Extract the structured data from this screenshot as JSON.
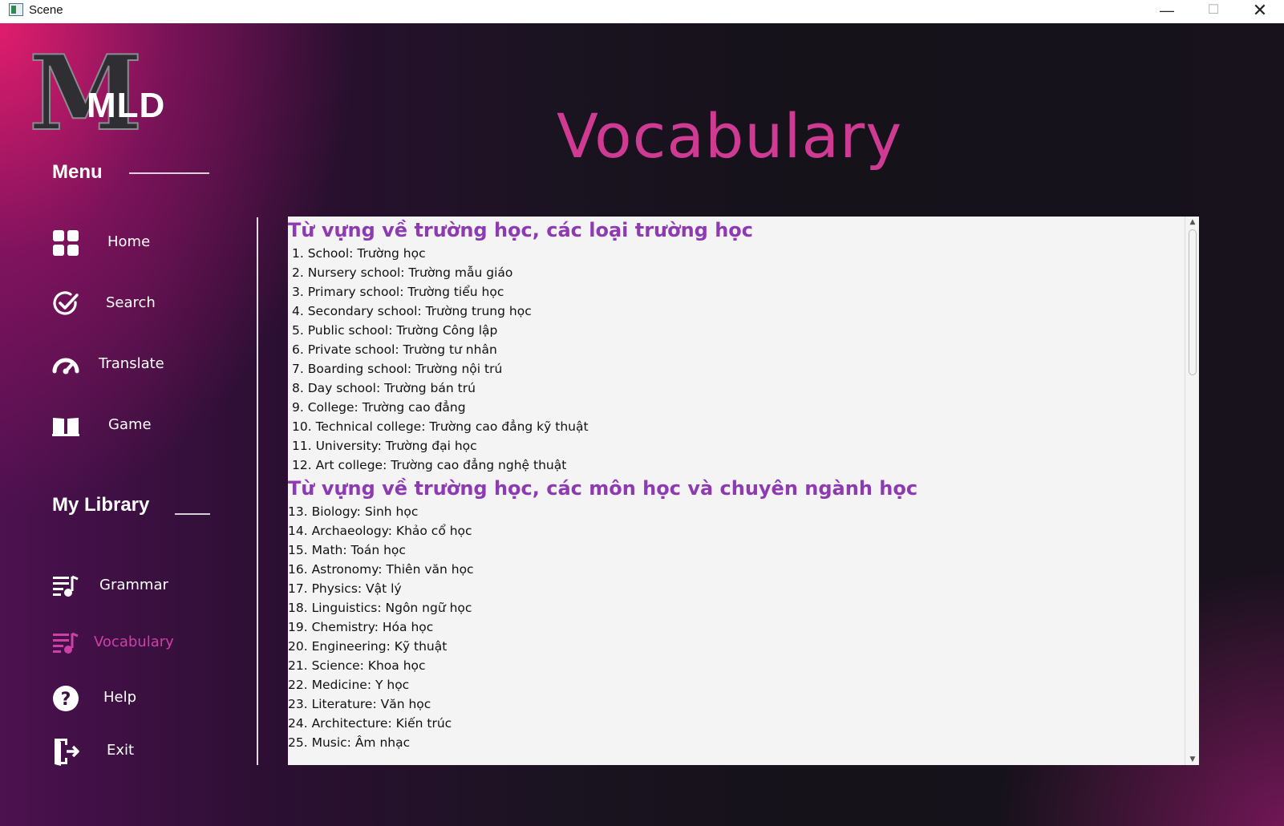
{
  "window": {
    "title": "Scene"
  },
  "logo": {
    "text": "MLD"
  },
  "sidebar": {
    "menu_title": "Menu",
    "library_title": "My Library",
    "menu_items": [
      {
        "label": "Home",
        "icon": "grid-icon"
      },
      {
        "label": "Search",
        "icon": "check-circle-icon"
      },
      {
        "label": "Translate",
        "icon": "gauge-icon"
      },
      {
        "label": "Game",
        "icon": "book-icon"
      }
    ],
    "library_items": [
      {
        "label": "Grammar",
        "icon": "playlist-icon"
      },
      {
        "label": "Vocabulary",
        "icon": "playlist-icon",
        "active": true
      },
      {
        "label": "Help",
        "icon": "question-icon"
      },
      {
        "label": "Exit",
        "icon": "exit-door-icon"
      }
    ]
  },
  "page": {
    "title": "Vocabulary"
  },
  "colors": {
    "accent": "#cf3a92",
    "heading": "#8e3ab3",
    "active_nav": "#cf40a6"
  },
  "sections": [
    {
      "heading": "Từ vựng về trường học, các loại trường học",
      "items": [
        "1. School: Trường học",
        "2. Nursery school: Trường mẫu giáo",
        "3. Primary school: Trường tiểu học",
        "4. Secondary school: Trường trung học",
        "5. Public school: Trường Công lập",
        "6. Private school: Trường tư nhân",
        "7. Boarding school: Trường nội trú",
        "8. Day school: Trường bán trú",
        "9. College: Trường cao đẳng",
        "10. Technical college: Trường cao đẳng kỹ thuật",
        "11. University: Trường đại học",
        "12. Art college: Trường cao đẳng nghệ thuật"
      ]
    },
    {
      "heading": "Từ vựng về trường học, các môn học và chuyên ngành học",
      "items": [
        "13. Biology: Sinh học",
        "14. Archaeology: Khảo cổ học",
        "15. Math: Toán học",
        "16. Astronomy: Thiên văn học",
        "17. Physics: Vật lý",
        "18. Linguistics: Ngôn ngữ học",
        "19. Chemistry: Hóa học",
        "20. Engineering: Kỹ thuật",
        "21. Science: Khoa học",
        "22. Medicine: Y học",
        "23. Literature: Văn học",
        "24. Architecture: Kiến trúc",
        "25. Music: Âm nhạc"
      ]
    }
  ]
}
